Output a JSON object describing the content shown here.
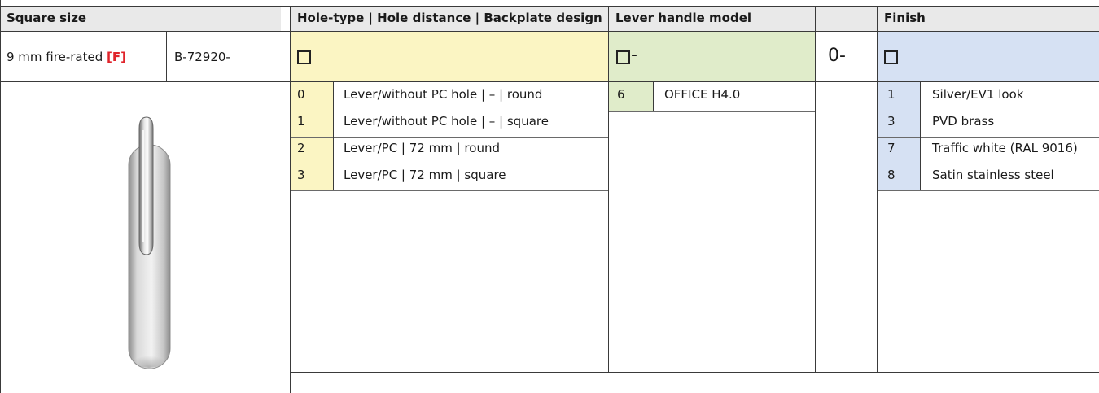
{
  "headers": {
    "square_size": "Square size",
    "hole_type": "Hole-type | Hole distance | Backplate design",
    "lever_model": "Lever handle model",
    "finish": "Finish"
  },
  "selection_row": {
    "square_size_value": "9 mm fire-rated",
    "fire_code": "[F]",
    "article_prefix": "B-72920-",
    "lever_suffix": "-",
    "fixed_code": "0-"
  },
  "hole_options": [
    {
      "code": "0",
      "label": "Lever/without PC hole | – | round"
    },
    {
      "code": "1",
      "label": "Lever/without PC hole | – | square"
    },
    {
      "code": "2",
      "label": "Lever/PC | 72 mm | round"
    },
    {
      "code": "3",
      "label": "Lever/PC | 72 mm | square"
    }
  ],
  "lever_options": [
    {
      "code": "6",
      "label": "OFFICE H4.0"
    }
  ],
  "finish_options": [
    {
      "code": "1",
      "label": "Silver/EV1 look"
    },
    {
      "code": "3",
      "label": "PVD brass"
    },
    {
      "code": "7",
      "label": "Traffic white (RAL 9016)"
    },
    {
      "code": "8",
      "label": "Satin stainless steel"
    }
  ],
  "colors": {
    "header_bg": "#e9e9e9",
    "hole_fill": "#fbf5c3",
    "lever_fill": "#e0ecca",
    "finish_fill": "#d6e1f3",
    "fire_red": "#e0242b"
  },
  "image": {
    "icon": "door-lever-handle-image"
  }
}
